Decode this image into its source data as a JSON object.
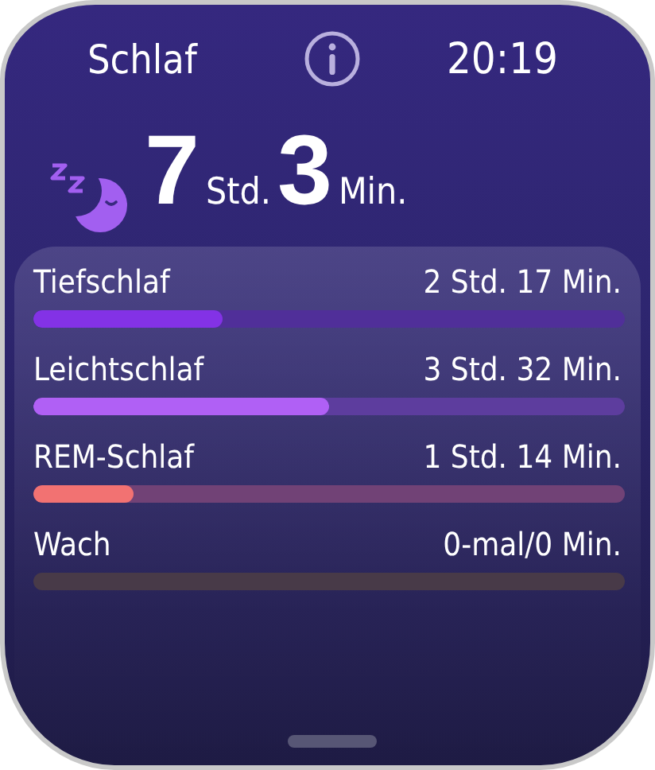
{
  "header": {
    "title": "Schlaf",
    "time": "20:19"
  },
  "total": {
    "hours": "7",
    "hours_unit": "Std.",
    "minutes": "3",
    "minutes_unit": "Min."
  },
  "stages": [
    {
      "name": "Tiefschlaf",
      "duration": "2 Std. 17 Min.",
      "level": 0.32,
      "color": "#8332e6"
    },
    {
      "name": "Leichtschlaf",
      "duration": "3 Std. 32 Min.",
      "level": 0.5,
      "color": "#b060f5"
    },
    {
      "name": "REM-Schlaf",
      "duration": "1 Std. 14 Min.",
      "level": 0.17,
      "color": "#f27272"
    },
    {
      "name": "Wach",
      "duration": "0-mal/0 Min."
    }
  ]
}
